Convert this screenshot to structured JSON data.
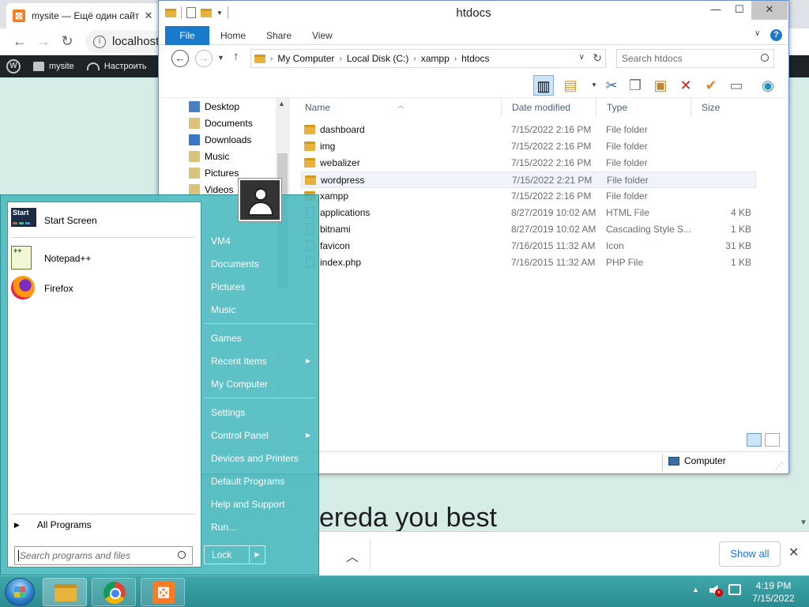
{
  "browser": {
    "tab_title": "mysite — Ещё один сайт",
    "tab_close": "✕",
    "url": "localhost/",
    "wp_bar": {
      "site_name": "mysite",
      "new_label": "Настроить"
    },
    "page_heading": "ereda you best",
    "download_bar": {
      "show_all": "Show all",
      "close": "✕"
    }
  },
  "explorer": {
    "title": "htdocs",
    "ribbon": {
      "file": "File",
      "tabs": [
        "Home",
        "Share",
        "View"
      ],
      "help": "?"
    },
    "address": {
      "segments": [
        "My Computer",
        "Local Disk (C:)",
        "xampp",
        "htdocs"
      ]
    },
    "search_placeholder": "Search htdocs",
    "nav_items": [
      {
        "label": "Desktop",
        "color": "#4a7fc1"
      },
      {
        "label": "Documents",
        "color": "#d9c27b"
      },
      {
        "label": "Downloads",
        "color": "#3a78c4"
      },
      {
        "label": "Music",
        "color": "#d9c27b"
      },
      {
        "label": "Pictures",
        "color": "#d9c27b"
      },
      {
        "label": "Videos",
        "color": "#d9c27b"
      }
    ],
    "columns": [
      "Name",
      "Date modified",
      "Type",
      "Size"
    ],
    "files": [
      {
        "name": "dashboard",
        "date": "7/15/2022 2:16 PM",
        "type": "File folder",
        "size": "",
        "kind": "folder"
      },
      {
        "name": "img",
        "date": "7/15/2022 2:16 PM",
        "type": "File folder",
        "size": "",
        "kind": "folder"
      },
      {
        "name": "webalizer",
        "date": "7/15/2022 2:16 PM",
        "type": "File folder",
        "size": "",
        "kind": "folder"
      },
      {
        "name": "wordpress",
        "date": "7/15/2022 2:21 PM",
        "type": "File folder",
        "size": "",
        "kind": "folder"
      },
      {
        "name": "xampp",
        "date": "7/15/2022 2:16 PM",
        "type": "File folder",
        "size": "",
        "kind": "folder"
      },
      {
        "name": "applications",
        "date": "8/27/2019 10:02 AM",
        "type": "HTML File",
        "size": "4 KB",
        "kind": "file"
      },
      {
        "name": "bitnami",
        "date": "8/27/2019 10:02 AM",
        "type": "Cascading Style S...",
        "size": "1 KB",
        "kind": "file"
      },
      {
        "name": "favicon",
        "date": "7/16/2015 11:32 AM",
        "type": "Icon",
        "size": "31 KB",
        "kind": "file"
      },
      {
        "name": "index.php",
        "date": "7/16/2015 11:32 AM",
        "type": "PHP File",
        "size": "1 KB",
        "kind": "file"
      }
    ],
    "status_location": "Computer"
  },
  "startmenu": {
    "pinned": [
      {
        "label": "Start Screen",
        "icon_text": "Start"
      },
      {
        "label": "Notepad++",
        "icon_text": "++"
      },
      {
        "label": "Firefox"
      }
    ],
    "all_programs": "All Programs",
    "search_placeholder": "Search programs and files",
    "right_items": [
      {
        "label": "VM4"
      },
      {
        "label": "Documents"
      },
      {
        "label": "Pictures"
      },
      {
        "label": "Music"
      },
      {
        "label": "Games"
      },
      {
        "label": "Recent Items",
        "submenu": true
      },
      {
        "label": "My Computer"
      },
      {
        "label": "Settings"
      },
      {
        "label": "Control Panel",
        "submenu": true
      },
      {
        "label": "Devices and Printers"
      },
      {
        "label": "Default Programs"
      },
      {
        "label": "Help and Support"
      },
      {
        "label": "Run..."
      }
    ],
    "lock_label": "Lock"
  },
  "taskbar": {
    "time": "4:19 PM",
    "date": "7/15/2022"
  }
}
